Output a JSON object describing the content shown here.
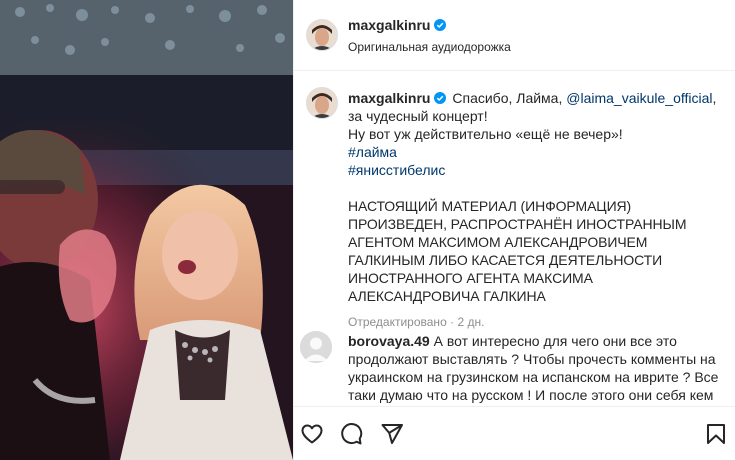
{
  "post": {
    "username": "maxgalkinru",
    "audio": "Оригинальная аудиодорожка"
  },
  "caption": {
    "username": "maxgalkinru",
    "text_before_mention": "Спасибо, Лайма, ",
    "mention": "@laima_vaikule_official",
    "text_after_mention": ", за чудесный концерт!",
    "line2": "Ну вот уж действительно «ещё не вечер»!",
    "hashtag1": "#лайма",
    "hashtag2": "#янисстибелис",
    "notice": "НАСТОЯЩИЙ МАТЕРИАЛ (ИНФОРМАЦИЯ) ПРОИЗВЕДЕН, РАСПРОСТРАНЁН ИНОСТРАННЫМ АГЕНТОМ МАКСИМОМ АЛЕКСАНДРОВИЧЕМ ГАЛКИНЫМ ЛИБО КАСАЕТСЯ ДЕЯТЕЛЬНОСТИ ИНОСТРАННОГО АГЕНТА МАКСИМА АЛЕКСАНДРОВИЧА ГАЛКИНА",
    "edited": "Отредактировано",
    "separator": "·",
    "time": "2 дн."
  },
  "comment": {
    "username": "borovaya.49",
    "text": "А вот интересно для чего они все это продолжают выставлять ? Чтобы прочесть комменты на украинском на грузинском на испанском на иврите ? Все таки думаю что на русском ! И после этого они себя кем"
  },
  "icons": {
    "like": "heart-icon",
    "comment": "comment-icon",
    "share": "paper-plane-icon",
    "save": "bookmark-icon",
    "verified": "verified-badge-icon"
  },
  "colors": {
    "link": "#00376b",
    "verified": "#0095f6",
    "meta": "#8e8e8e"
  }
}
